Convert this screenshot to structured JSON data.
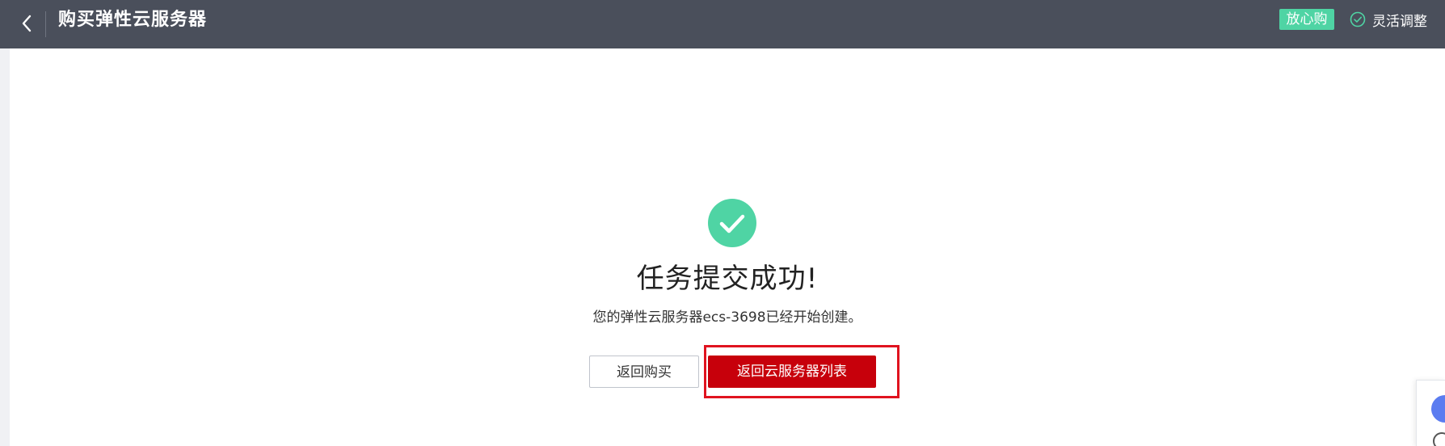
{
  "header": {
    "title": "购买弹性云服务器",
    "badge_label": "放心购",
    "flex_adjust_label": "灵活调整"
  },
  "result": {
    "title": "任务提交成功!",
    "message": "您的弹性云服务器ecs-3698已经开始创建。"
  },
  "actions": {
    "back_to_purchase": "返回购买",
    "back_to_list": "返回云服务器列表"
  },
  "colors": {
    "header_bg": "#4a4f5b",
    "success_green": "#4fd4a4",
    "primary_red": "#c7000b",
    "highlight_red": "#e0131f"
  },
  "icons": [
    "back-arrow-icon",
    "check-circle-outline-icon",
    "success-check-icon"
  ]
}
